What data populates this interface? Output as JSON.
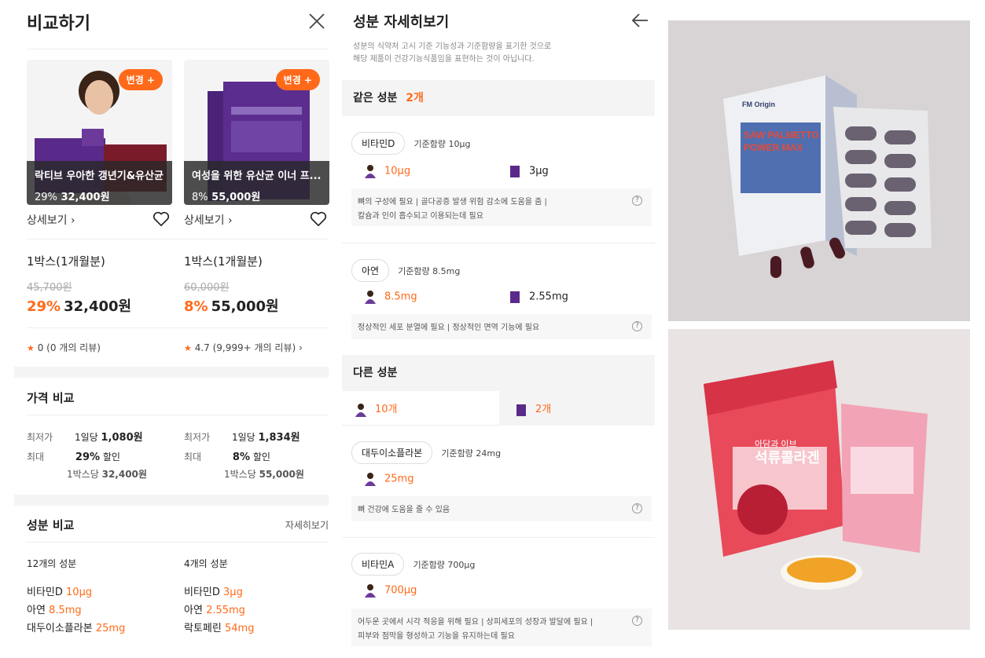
{
  "compare": {
    "title": "비교하기",
    "change_label": "변경 +",
    "detail_label": "상세보기",
    "products": [
      {
        "card_name": "락티브 우아한 갱년기&유산균",
        "card_discount": "29%",
        "card_price": "32,400원",
        "box": "1박스(1개월분)",
        "original_price": "45,700원",
        "discount": "29%",
        "price": "32,400원",
        "review": "0 (0 개의 리뷰)"
      },
      {
        "card_name": "여성을 위한 유산균 이너 프...",
        "card_discount": "8%",
        "card_price": "55,000원",
        "box": "1박스(1개월분)",
        "original_price": "60,000원",
        "discount": "8%",
        "price": "55,000원",
        "review": "4.7 (9,999+ 개의 리뷰)"
      }
    ],
    "price_compare": {
      "title": "가격 비교",
      "lowest_label": "최저가",
      "max_label": "최대",
      "per_day_label": "1일당",
      "discount_label": "할인",
      "per_box_label": "1박스당",
      "items": [
        {
          "per_day": "1,080원",
          "discount": "29%",
          "per_box": "32,400원"
        },
        {
          "per_day": "1,834원",
          "discount": "8%",
          "per_box": "55,000원"
        }
      ]
    },
    "ingredient_compare": {
      "title": "성분 비교",
      "detail_link": "자세히보기",
      "columns": [
        {
          "count": "12개의 성분",
          "rows": [
            {
              "name": "비타민D",
              "value": "10μg"
            },
            {
              "name": "아연",
              "value": "8.5mg"
            },
            {
              "name": "대두이소플라본",
              "value": "25mg"
            }
          ]
        },
        {
          "count": "4개의 성분",
          "rows": [
            {
              "name": "비타민D",
              "value": "3μg"
            },
            {
              "name": "아연",
              "value": "2.55mg"
            },
            {
              "name": "락토페린",
              "value": "54mg"
            }
          ]
        }
      ]
    }
  },
  "detail": {
    "title": "성분 자세히보기",
    "notice_line1": "성분의 식약처 고시 기준 기능성과 기준함량을 표기한 것으로",
    "notice_line2": "해당 제품이 건강기능식품임을 표현하는 것이 아닙니다.",
    "same_label": "같은 성분",
    "same_count": "2개",
    "different_label": "다른 성분",
    "diff_left": "10개",
    "diff_right": "2개",
    "basis_prefix": "기준함량",
    "ingredients": [
      {
        "name": "비타민D",
        "basis": "10μg",
        "a": "10μg",
        "b": "3μg",
        "desc1": "뼈의 구성에 필요 | 골다공증 발생 위험 감소에 도움을 줌 |",
        "desc2": "칼슘과 인이 흡수되고 이용되는데 필요"
      },
      {
        "name": "아연",
        "basis": "8.5mg",
        "a": "8.5mg",
        "b": "2.55mg",
        "desc1": "정상적인 세포 분열에 필요 | 정상적인 면역 기능에 필요",
        "desc2": ""
      },
      {
        "name": "대두이소플라본",
        "basis": "24mg",
        "a": "25mg",
        "desc1": "뼈 건강에 도움을 줄 수 있음",
        "desc2": ""
      },
      {
        "name": "비타민A",
        "basis": "700μg",
        "a": "700μg",
        "desc1": "어두운 곳에서 시각 적응을 위해 필요 | 상피세포의 성장과 발달에 필요 |",
        "desc2": "피부와 점막을 형성하고 기능을 유지하는데 필요"
      }
    ]
  },
  "photos": {
    "top_brand": "FM Origin",
    "top_product_line1": "SAW PALMETTO",
    "top_product_line2": "POWER MAX",
    "bottom_small": "아담과 이브",
    "bottom_product": "석류콜라겐"
  },
  "colors": {
    "accent": "#ff6a1a",
    "purple": "#5a2a8a"
  }
}
